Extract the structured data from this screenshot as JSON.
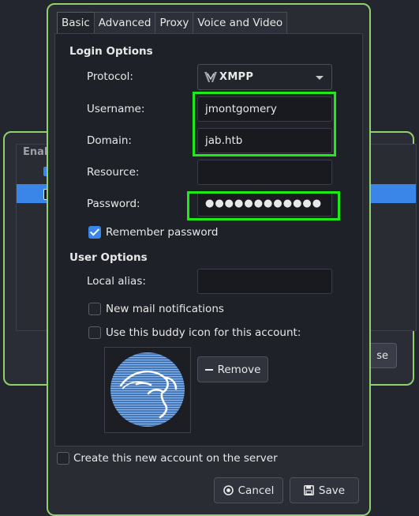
{
  "background_window": {
    "list_header": "Enab",
    "button_fragment": "se"
  },
  "tabs": [
    {
      "label": "Basic",
      "active": true
    },
    {
      "label": "Advanced",
      "active": false
    },
    {
      "label": "Proxy",
      "active": false
    },
    {
      "label": "Voice and Video",
      "active": false
    }
  ],
  "login_options": {
    "title": "Login Options",
    "protocol_label": "Protocol:",
    "protocol_value": "XMPP",
    "username_label": "Username:",
    "username_value": "jmontgomery",
    "domain_label": "Domain:",
    "domain_value": "jab.htb",
    "resource_label": "Resource:",
    "resource_value": "",
    "password_label": "Password:",
    "password_value": "●●●●●●●●●●●●",
    "remember_label": "Remember password",
    "remember_checked": true
  },
  "user_options": {
    "title": "User Options",
    "alias_label": "Local alias:",
    "alias_value": "",
    "mail_label": "New mail notifications",
    "mail_checked": false,
    "buddy_icon_label": "Use this buddy icon for this account:",
    "buddy_icon_checked": false,
    "remove_label": "Remove"
  },
  "footer": {
    "create_account_label": "Create this new account on the server",
    "create_account_checked": false,
    "cancel_label": "Cancel",
    "save_label": "Save"
  },
  "colors": {
    "accent_blue": "#3a86e8",
    "highlight_green": "#1eea17",
    "window_border": "#8fd16a"
  }
}
